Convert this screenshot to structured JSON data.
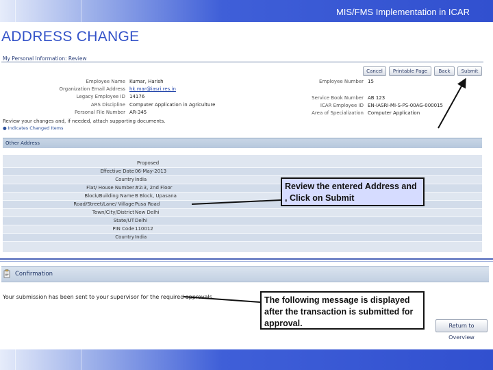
{
  "banner": {
    "title": "MIS/FMS Implementation in ICAR"
  },
  "heading": "ADDRESS CHANGE",
  "review_screen": {
    "title": "My Personal Information: Review",
    "buttons": {
      "cancel": "Cancel",
      "printable": "Printable Page",
      "back": "Back",
      "submit": "Submit"
    },
    "left_fields": [
      {
        "label": "Employee Name",
        "value": "Kumar, Harish",
        "link": false
      },
      {
        "label": "Organization Email Address",
        "value": "hk.mar@iasri.res.in",
        "link": true
      },
      {
        "label": "Legacy Employee ID",
        "value": "14176",
        "link": false
      },
      {
        "label": "ARS Discipline",
        "value": "Computer Application in Agriculture",
        "link": false
      },
      {
        "label": "Personal File Number",
        "value": "AR-345",
        "link": false
      }
    ],
    "right_fields": [
      {
        "label": "Employee Number",
        "value": "15"
      },
      {
        "label": "Service Book Number",
        "value": "AB 123"
      },
      {
        "label": "ICAR Employee ID",
        "value": "EN-IASRI-MI-S-PS-00AG-000015"
      },
      {
        "label": "Area of Specialization",
        "value": "Computer Application"
      }
    ],
    "note": "Review your changes and, if needed, attach supporting documents.",
    "changed_note": "● Indicates Changed Items",
    "section_title": "Other Address",
    "column_header": "Proposed",
    "rows": [
      {
        "label": "Effective Date",
        "value": "06-May-2013"
      },
      {
        "label": "Country",
        "value": "India"
      },
      {
        "label": "Flat/ House Number",
        "value": "#2:3, 2nd Floor"
      },
      {
        "label": "Block/Building Name",
        "value": "B Block, Upasana"
      },
      {
        "label": "Road/Street/Lane/ Village",
        "value": "Pusa Road"
      },
      {
        "label": "Town/City/District",
        "value": "New Delhi"
      },
      {
        "label": "State/UT",
        "value": "Delhi"
      },
      {
        "label": "PIN Code",
        "value": "110012"
      },
      {
        "label": "Country",
        "value": "India"
      }
    ]
  },
  "confirmation_screen": {
    "title": "Confirmation",
    "message": "Your submission has been sent to your supervisor for the required approvals.",
    "return_button": "Return to Overview"
  },
  "callouts": {
    "review": "Review the entered Address and , Click on Submit",
    "confirmation": "The following message is displayed after the transaction is submitted for approval."
  },
  "colors": {
    "banner_blue": "#3150cf",
    "heading_blue": "#3352c8",
    "callout_fill": "#d6dcff"
  }
}
